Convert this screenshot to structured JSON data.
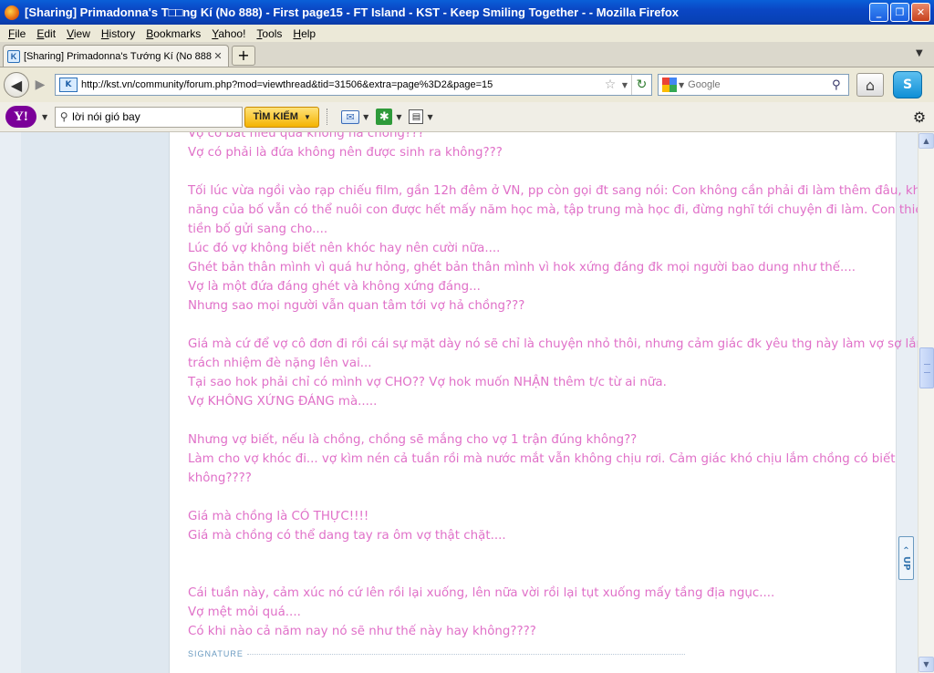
{
  "window": {
    "title": "[Sharing] Primadonna's T□□ng Kí (No 888) - First page15 - FT Island - KST - Keep Smiling Together - - Mozilla Firefox"
  },
  "menu": {
    "items": [
      "File",
      "Edit",
      "View",
      "History",
      "Bookmarks",
      "Yahoo!",
      "Tools",
      "Help"
    ]
  },
  "tabs": {
    "active_label": "[Sharing] Primadonna's Tướng Kí (No 888) - ...",
    "new_tab": "+"
  },
  "nav": {
    "url": "http://kst.vn/community/forum.php?mod=viewthread&tid=31506&extra=page%3D2&page=15",
    "search_placeholder": "Google",
    "skype_label": "S"
  },
  "yahoo": {
    "logo": "Y!",
    "query": "lời nói gió bay",
    "search_button": "TÌM KIẾM"
  },
  "post": {
    "lines": [
      "Vợ có bất hiếu quá không hả chồng???",
      "Vợ có phải là đứa không nên được sinh ra không???",
      "",
      "Tối lúc vừa ngồi vào rạp chiếu film, gần 12h đêm ở VN, pp còn gọi đt sang nói: Con không cần phải đi làm thêm đâu, khả",
      "năng của bố vẫn có thể nuôi con được hết mấy năm học mà, tập trung mà học đi, đừng nghĩ tới chuyện đi làm. Con thiếu",
      "tiền bố gửi sang cho....",
      "Lúc đó vợ không biết nên khóc hay nên cười nữa....",
      "Ghét bản thân mình vì quá hư hỏng, ghét bản thân mình vì hok xứng đáng đk mọi người bao dung như thế....",
      "Vợ là một đứa đáng ghét và không xứng đáng...",
      "Nhưng sao mọi người vẫn quan tâm tới vợ hả chồng???",
      "",
      "Giá mà cứ để vợ cô đơn đi rồi cái sự mặt dày nó sẽ chỉ là chuyện nhỏ thôi, nhưng cảm giác đk yêu thg này làm vợ sợ lắm,",
      "trách nhiệm đè nặng lên vai...",
      "Tại sao hok phải chỉ có mình vợ CHO?? Vợ hok muốn NHẬN thêm t/c từ ai nữa.",
      "Vợ KHÔNG XỨNG ĐÁNG mà.....",
      "",
      "Nhưng vợ biết, nếu là chồng, chồng sẽ mắng cho vợ 1 trận đúng không??",
      "Làm cho vợ khóc đi... vợ kìm nén cả tuần rồi mà nước mắt vẫn không chịu rơi. Cảm giác khó chịu lắm chồng có biết",
      "không????",
      "",
      "Giá mà chồng là CÓ THỰC!!!!",
      "Giá mà chồng có thể dang tay ra ôm vợ thật chặt....",
      "",
      "",
      "",
      "Cái tuần này, cảm xúc nó cứ lên rồi lại xuống, lên nữa vời rồi lại tụt xuống mấy tầng địa ngục....",
      "Vợ mệt mỏi quá....",
      "Có khi nào cả năm nay nó sẽ như thế này hay không????"
    ],
    "signature_label": "SIGNATURE",
    "up_tag": "UP"
  },
  "colors": {
    "post_text": "#e070c8",
    "titlebar": "#0a46c4"
  },
  "icons": {
    "back": "back-arrow-icon",
    "forward": "forward-arrow-icon",
    "bookmark": "star-icon",
    "reload": "reload-icon",
    "home": "home-icon",
    "settings": "gear-icon",
    "mail": "mail-icon"
  }
}
